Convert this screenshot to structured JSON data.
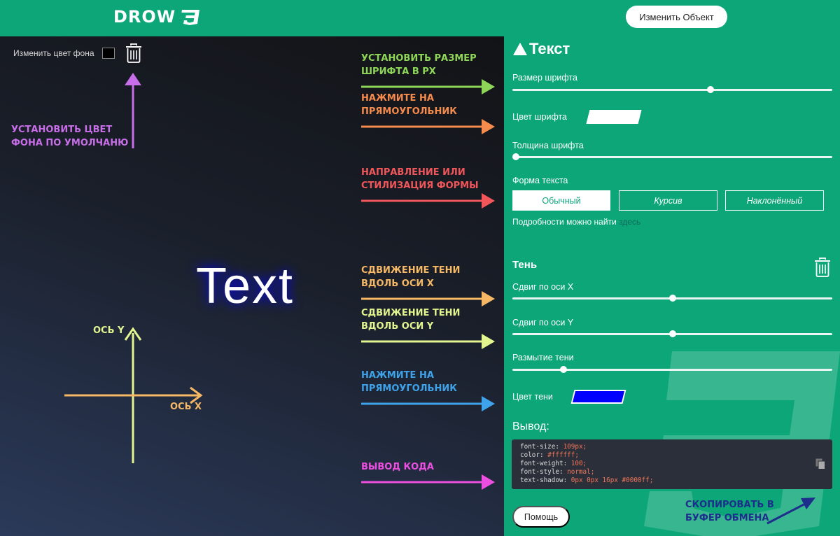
{
  "header": {
    "logo": "DROW",
    "edit_button": "Изменить Объект"
  },
  "canvas": {
    "bg_label": "Изменить цвет фона",
    "bg_color": "#000000",
    "preview_text": "Text",
    "axis_y": "ОСЬ Y",
    "axis_x": "ОСЬ X"
  },
  "annotations": {
    "set_bg": [
      "УСТАНОВИТЬ ЦВЕТ",
      "ФОНА ПО УМОЛЧАНЮ"
    ],
    "font_size": [
      "УСТАНОВИТЬ РАЗМЕР",
      "ШРИФТА В PX"
    ],
    "click_rect1": [
      "НАЖМИТЕ НА",
      "ПРЯМОУГОЛЬНИК"
    ],
    "direction": [
      "НАПРАВЛЕНИЕ ИЛИ",
      "СТИЛИЗАЦИЯ ФОРМЫ"
    ],
    "shift_x": [
      "СДВИЖЕНИЕ ТЕНИ",
      "ВДОЛЬ ОСИ X"
    ],
    "shift_y": [
      "СДВИЖЕНИЕ ТЕНИ",
      "ВДОЛЬ ОСИ Y"
    ],
    "click_rect2": [
      "НАЖМИТЕ НА",
      "ПРЯМОУГОЛЬНИК"
    ],
    "code_out": [
      "ВЫВОД КОДА"
    ],
    "copy": [
      "СКОПИРОВАТЬ В",
      "БУФЕР ОБМЕНА"
    ]
  },
  "colors": {
    "purple": "#c76ee8",
    "green": "#8ed657",
    "orange": "#f58b4c",
    "red": "#f0565a",
    "amber": "#f7b866",
    "lime": "#e2f58f",
    "blue": "#3ea3ea",
    "magenta": "#ec4fe0",
    "navy": "#1d2d8c"
  },
  "panel": {
    "title": "Текст",
    "font_size_label": "Размер шрифта",
    "font_size_value": 0.62,
    "font_color_label": "Цвет шрифта",
    "font_color": "#ffffff",
    "font_weight_label": "Толщина шрифта",
    "font_weight_value": 0.01,
    "text_form_label": "Форма текста",
    "forms": [
      "Обычный",
      "Курсив",
      "Наклонённый"
    ],
    "details_text": "Подробности можно найти",
    "details_link": "здесь",
    "shadow_title": "Тень",
    "shift_x_label": "Сдвиг по оси X",
    "shift_x_value": 0.5,
    "shift_y_label": "Сдвиг по оси Y",
    "shift_y_value": 0.5,
    "blur_label": "Размытие тени",
    "blur_value": 0.16,
    "shadow_color_label": "Цвет тени",
    "shadow_color": "#0000ff",
    "output_title": "Вывод:",
    "code": [
      {
        "k": "font-size:",
        "v": "109px;"
      },
      {
        "k": "color:",
        "v": "#ffffff;"
      },
      {
        "k": "font-weight:",
        "v": "100;"
      },
      {
        "k": "font-style:",
        "v": "normal;"
      },
      {
        "k": "text-shadow:",
        "v": "0px 0px 16px #0000ff;"
      }
    ],
    "help_button": "Помощь"
  }
}
